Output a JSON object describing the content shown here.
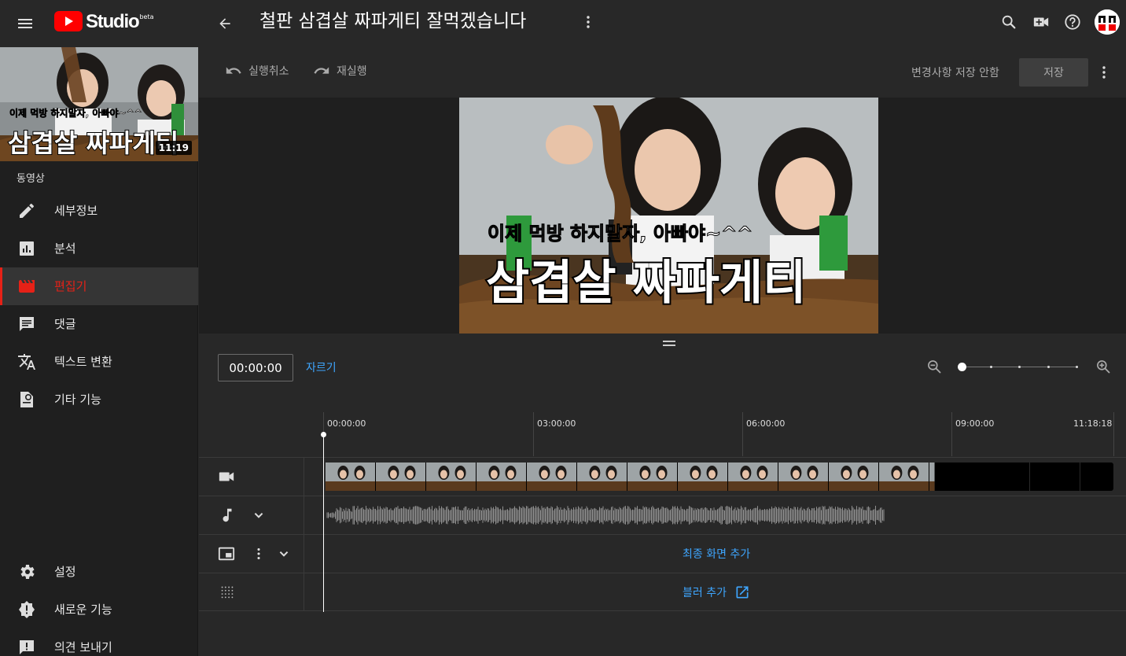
{
  "header": {
    "logo_text": "Studio",
    "logo_badge": "beta",
    "video_title": "철판 삼겹살 짜파게티 잘먹겠습니다",
    "icons": [
      "menu-icon",
      "back-arrow-icon",
      "more-vert-icon",
      "search-icon",
      "create-video-icon",
      "help-icon"
    ]
  },
  "sidebar": {
    "thumbnail": {
      "overlay_line1": "이제 먹방 하지말자, 아빠야~^^",
      "overlay_line2": "삼겹살 짜파게티",
      "duration": "11:19"
    },
    "section_label": "동영상",
    "items": [
      {
        "label": "세부정보",
        "icon": "pencil-icon"
      },
      {
        "label": "분석",
        "icon": "analytics-icon"
      },
      {
        "label": "편집기",
        "icon": "clapperboard-icon",
        "active": true
      },
      {
        "label": "댓글",
        "icon": "comment-icon"
      },
      {
        "label": "텍스트 변환",
        "icon": "translate-icon"
      },
      {
        "label": "기타 기능",
        "icon": "other-features-icon"
      }
    ],
    "bottom_items": [
      {
        "label": "설정",
        "icon": "gear-icon"
      },
      {
        "label": "새로운 기능",
        "icon": "alert-badge-icon"
      },
      {
        "label": "의견 보내기",
        "icon": "feedback-icon"
      }
    ]
  },
  "toolbar": {
    "undo_label": "실행취소",
    "redo_label": "재실행",
    "unsaved_text": "변경사항 저장 안함",
    "save_label": "저장"
  },
  "preview": {
    "caption_line1": "이제 먹방 하지말자, 아빠야~^^",
    "caption_line2": "삼겹살 짜파게티"
  },
  "timeline": {
    "current_time": "00:00:00",
    "trim_label": "자르기",
    "ruler": [
      "00:00:00",
      "03:00:00",
      "06:00:00",
      "09:00:00",
      "11:18:18"
    ],
    "playhead_fraction": 0,
    "video_fraction": 0.773,
    "audio_fraction": 0.71,
    "end_screen_label": "최종 화면 추가",
    "blur_label": "블러 추가",
    "colors": {
      "accent": "#3ea6ff",
      "active": "#e62117",
      "background": "#282828"
    }
  }
}
